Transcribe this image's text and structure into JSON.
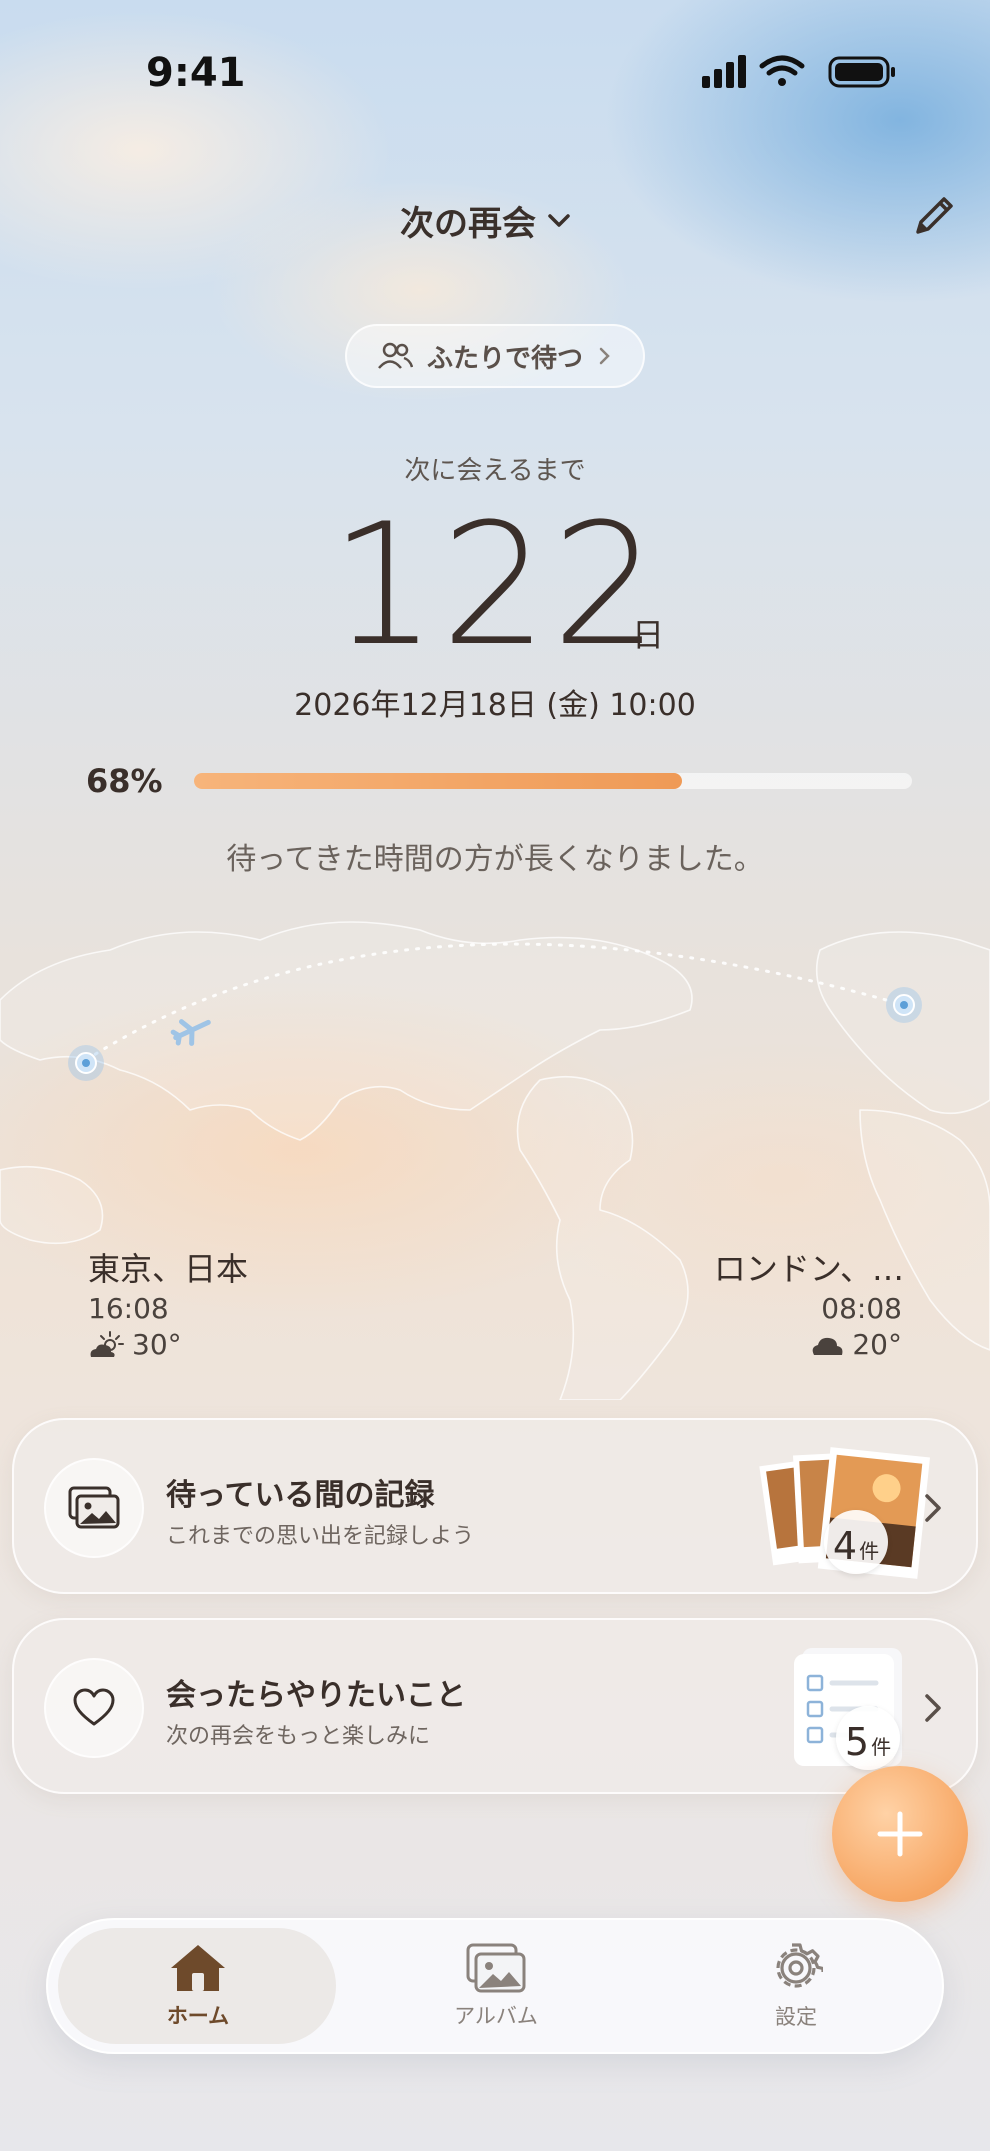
{
  "status_bar": {
    "time": "9:41"
  },
  "header": {
    "title": "次の再会",
    "together_label": "ふたりで待つ"
  },
  "countdown": {
    "label": "次に会えるまで",
    "days": "122",
    "unit": "日",
    "date": "2026年12月18日 (金) 10:00",
    "progress_text": "68%",
    "progress_fraction": 0.68,
    "message": "待ってきた時間の方が長くなりました。"
  },
  "cities": {
    "left": {
      "name": "東京、日本",
      "time": "16:08",
      "temp": "30°",
      "weather_icon": "sun-cloud-icon"
    },
    "right": {
      "name": "ロンドン、…",
      "time": "08:08",
      "temp": "20°",
      "weather_icon": "cloud-icon"
    }
  },
  "cards": [
    {
      "title": "待っている間の記録",
      "subtitle": "これまでの思い出を記録しよう",
      "count": "4",
      "count_unit": "件",
      "icon": "photo-gallery-icon"
    },
    {
      "title": "会ったらやりたいこと",
      "subtitle": "次の再会をもっと楽しみに",
      "count": "5",
      "count_unit": "件",
      "icon": "heart-icon"
    }
  ],
  "tabbar": {
    "tabs": [
      {
        "label": "ホーム",
        "icon": "home-icon",
        "active": true
      },
      {
        "label": "アルバム",
        "icon": "album-icon",
        "active": false
      },
      {
        "label": "設定",
        "icon": "gear-icon",
        "active": false
      }
    ]
  },
  "colors": {
    "accent": "#F09A55",
    "brown": "#6E4A2B",
    "text": "#3A2F2A"
  }
}
